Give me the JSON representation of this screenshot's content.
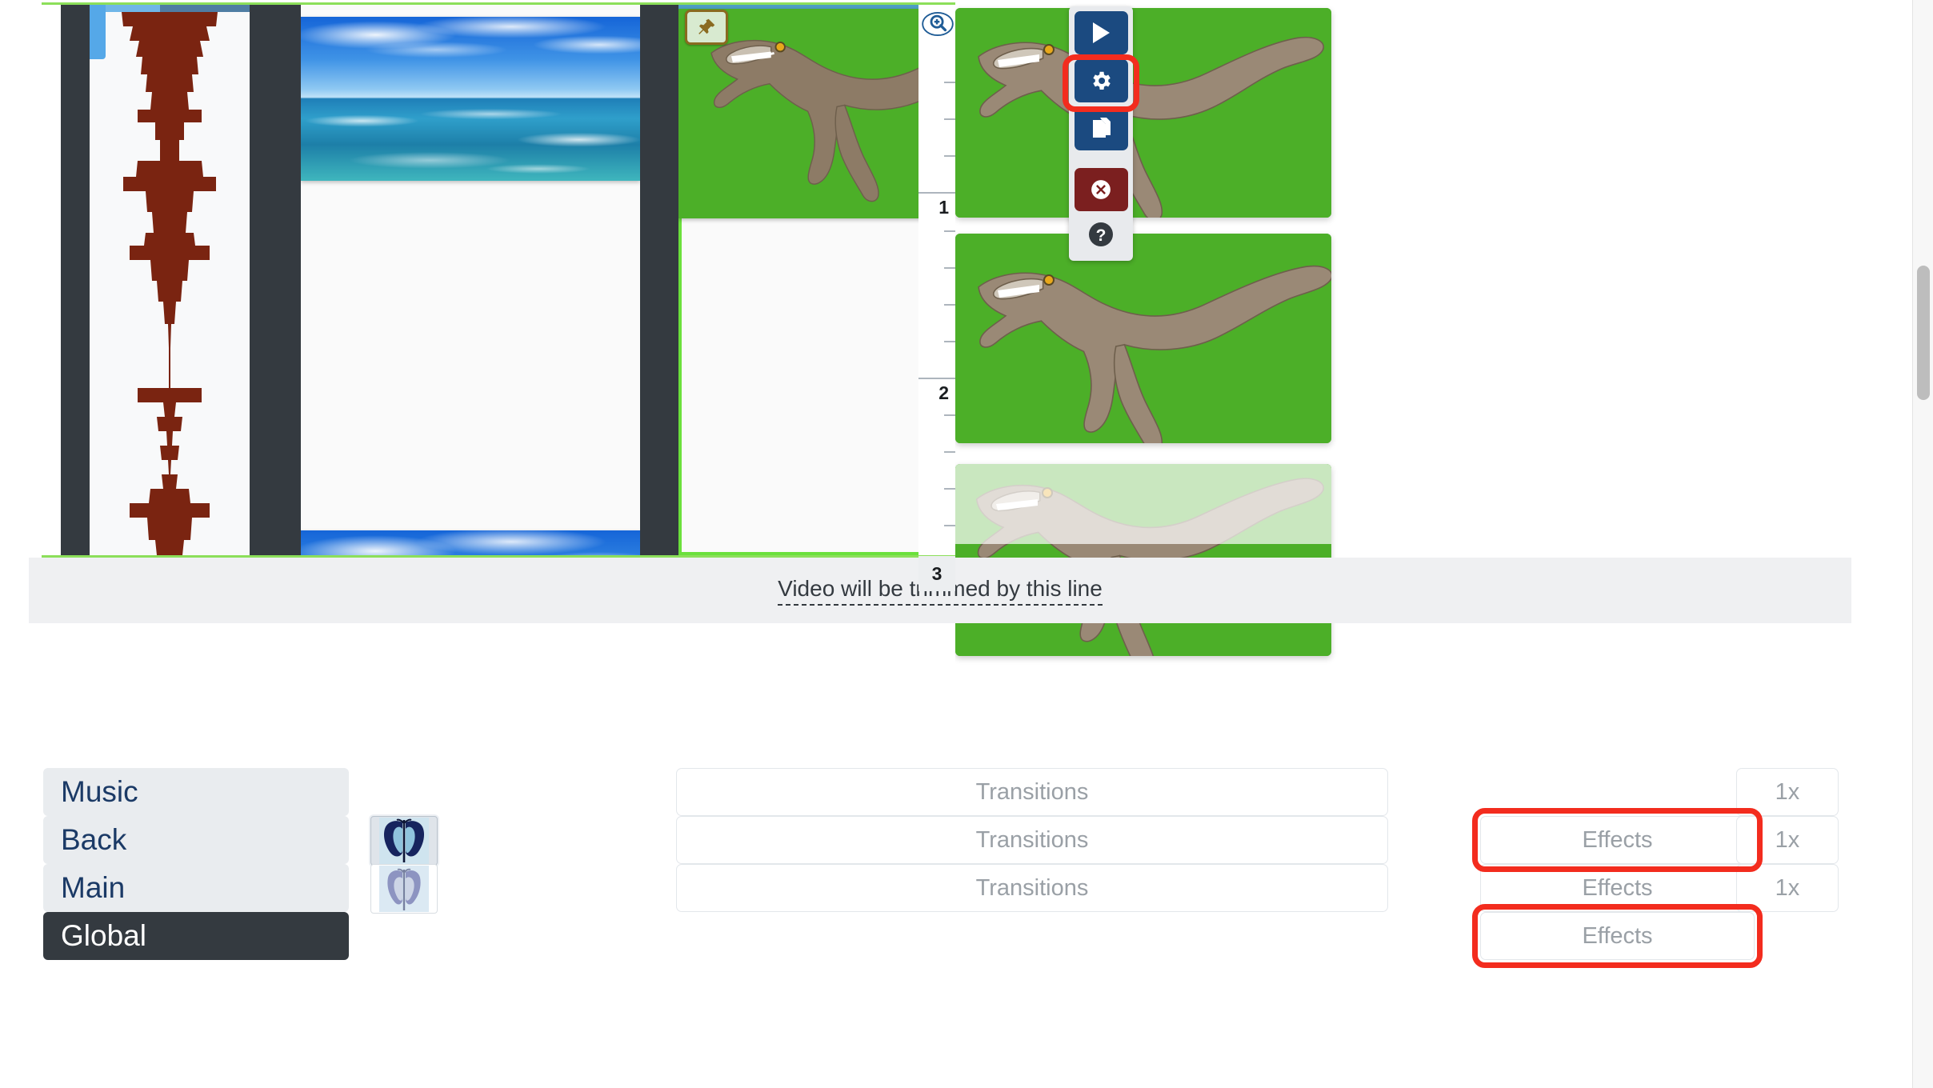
{
  "app": {
    "title": "Video Editor Timeline",
    "accent_green": "#6be03c",
    "accent_blue": "#1b4a80",
    "accent_red": "#7b1f1f",
    "highlight_color": "#f32c1e",
    "greenscreen_color": "#4caf28",
    "dark_panel": "#343a40"
  },
  "timeline": {
    "trim_notice": "Video will be trimmed by this line",
    "pin_icon": "pin-icon",
    "tracks": [
      {
        "name": "audio-waveform-track",
        "type": "waveform",
        "waveform_color": "#7a2411",
        "selected": false
      },
      {
        "name": "ocean-video-track",
        "type": "video",
        "frames": [
          "ocean",
          "ocean"
        ],
        "selected": false
      },
      {
        "name": "dinosaur-video-track",
        "type": "video",
        "frames": [
          "greenscreen-raptor",
          "greenscreen-raptor"
        ],
        "selected": true,
        "pinned": true
      }
    ]
  },
  "toolbar": {
    "buttons": [
      {
        "name": "play-button",
        "icon": "play-icon",
        "style": "blue",
        "highlighted": false
      },
      {
        "name": "settings-button",
        "icon": "gear-icon",
        "style": "blue",
        "highlighted": true
      },
      {
        "name": "duplicate-button",
        "icon": "copy-icon",
        "style": "blue",
        "highlighted": false
      },
      {
        "name": "delete-button",
        "icon": "close-circle-icon",
        "style": "red",
        "highlighted": false
      },
      {
        "name": "help-button",
        "icon": "question-icon",
        "style": "help",
        "highlighted": false
      }
    ]
  },
  "ruler": {
    "zoom_icon": "zoom-in-icon",
    "marks": [
      "1",
      "2",
      "3"
    ]
  },
  "preview": {
    "thumbnails": [
      {
        "name": "preview-thumb-1",
        "label": "1"
      },
      {
        "name": "preview-thumb-2",
        "label": "2"
      },
      {
        "name": "preview-thumb-3",
        "label": "3"
      }
    ]
  },
  "track_panel": {
    "rows": [
      {
        "name": "music",
        "label": "Music",
        "style": "normal",
        "thumbnail": null,
        "transitions_label": "Transitions",
        "effects_label": null,
        "speed_label": "1x",
        "effects_highlighted": false
      },
      {
        "name": "back",
        "label": "Back",
        "style": "normal",
        "thumbnail": "butterfly-dark",
        "transitions_label": "Transitions",
        "effects_label": "Effects",
        "speed_label": "1x",
        "effects_highlighted": true
      },
      {
        "name": "main",
        "label": "Main",
        "style": "normal",
        "thumbnail": "butterfly-light",
        "transitions_label": "Transitions",
        "effects_label": "Effects",
        "speed_label": "1x",
        "effects_highlighted": false
      },
      {
        "name": "global",
        "label": "Global",
        "style": "dark",
        "thumbnail": null,
        "transitions_label": null,
        "effects_label": "Effects",
        "speed_label": null,
        "effects_highlighted": true
      }
    ]
  },
  "scrollbar": {
    "name": "vertical-scrollbar",
    "thumb_top_pct": 24,
    "thumb_height_pct": 12
  }
}
